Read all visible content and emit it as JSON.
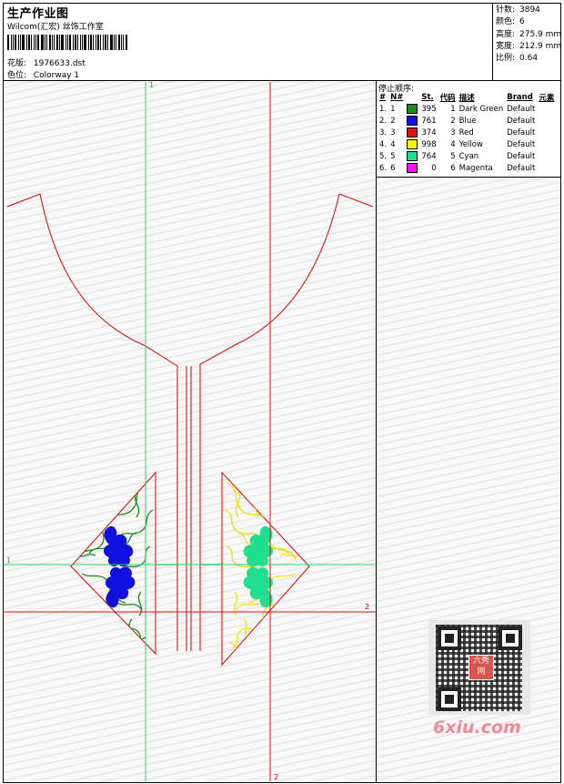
{
  "header": {
    "title": "生产作业图",
    "studio": "Wilcom(汇宏) 丝饰工作室",
    "design_label": "花版:",
    "design_value": "1976633.dst",
    "colorway_label": "色位:",
    "colorway_value": "Colorway 1"
  },
  "stats": {
    "stitches_label": "针数:",
    "stitches": "3894",
    "colors_label": "颜色:",
    "colors": "6",
    "height_label": "高度:",
    "height": "275.9 mm",
    "width_label": "宽度:",
    "width": "212.9 mm",
    "scale_label": "比例:",
    "scale": "0.64"
  },
  "legend": {
    "title": "停止顺序:",
    "headers": [
      "#",
      "N#",
      "St.",
      "代码",
      "描述",
      "Brand",
      "元素"
    ],
    "rows": [
      {
        "idx": "1.",
        "n": "1",
        "st": "395",
        "code": "1",
        "desc": "Dark Green",
        "brand": "Default",
        "color": "#1a8a1a"
      },
      {
        "idx": "2.",
        "n": "2",
        "st": "761",
        "code": "2",
        "desc": "Blue",
        "brand": "Default",
        "color": "#1010e0"
      },
      {
        "idx": "3.",
        "n": "3",
        "st": "374",
        "code": "3",
        "desc": "Red",
        "brand": "Default",
        "color": "#e01010"
      },
      {
        "idx": "4.",
        "n": "4",
        "st": "998",
        "code": "4",
        "desc": "Yellow",
        "brand": "Default",
        "color": "#f5f500"
      },
      {
        "idx": "5.",
        "n": "5",
        "st": "764",
        "code": "5",
        "desc": "Cyan",
        "brand": "Default",
        "color": "#20e090"
      },
      {
        "idx": "6.",
        "n": "6",
        "st": "0",
        "code": "6",
        "desc": "Magenta",
        "brand": "Default",
        "color": "#ff10ff"
      }
    ]
  },
  "axes": {
    "v_green": "1",
    "h_green": "1",
    "v_red": "2",
    "h_red": "2"
  },
  "watermark": "6xiu.com",
  "stamp": "六秀网"
}
